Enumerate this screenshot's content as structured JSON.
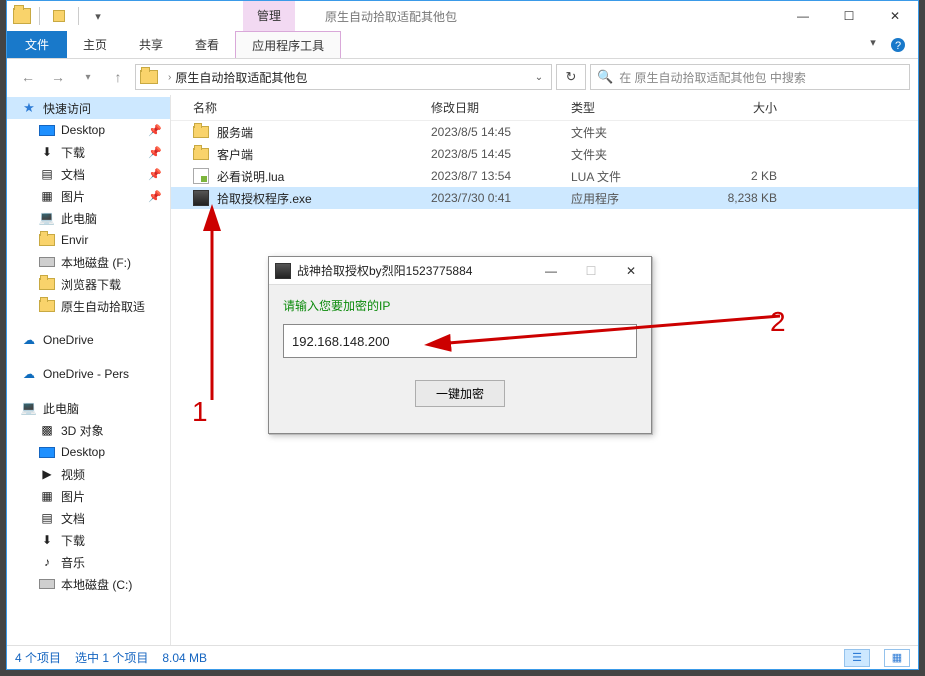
{
  "window": {
    "context_tab_group": "管理",
    "title": "原生自动拾取适配其他包",
    "controls": {
      "min": "—",
      "max": "☐",
      "close": "✕"
    }
  },
  "ribbon": {
    "file": "文件",
    "tabs": [
      "主页",
      "共享",
      "查看"
    ],
    "context_tab": "应用程序工具",
    "expand_icon": "▾"
  },
  "address": {
    "path_segment": "原生自动拾取适配其他包",
    "search_placeholder": "在 原生自动拾取适配其他包 中搜索"
  },
  "sidebar": {
    "quick_access": "快速访问",
    "items": [
      {
        "label": "Desktop",
        "pin": true
      },
      {
        "label": "下载",
        "pin": true
      },
      {
        "label": "文档",
        "pin": true
      },
      {
        "label": "图片",
        "pin": true
      },
      {
        "label": "此电脑",
        "pin": false
      },
      {
        "label": "Envir",
        "pin": false
      },
      {
        "label": "本地磁盘 (F:)",
        "pin": false
      },
      {
        "label": "浏览器下载",
        "pin": false
      },
      {
        "label": "原生自动拾取适",
        "pin": false
      }
    ],
    "onedrive": "OneDrive",
    "onedrive_personal": "OneDrive - Pers",
    "this_pc": "此电脑",
    "pc_items": [
      "3D 对象",
      "Desktop",
      "视频",
      "图片",
      "文档",
      "下载",
      "音乐",
      "本地磁盘 (C:)"
    ]
  },
  "columns": {
    "name": "名称",
    "date": "修改日期",
    "type": "类型",
    "size": "大小"
  },
  "files": [
    {
      "name": "服务端",
      "date": "2023/8/5 14:45",
      "type": "文件夹",
      "size": ""
    },
    {
      "name": "客户端",
      "date": "2023/8/5 14:45",
      "type": "文件夹",
      "size": ""
    },
    {
      "name": "必看说明.lua",
      "date": "2023/8/7 13:54",
      "type": "LUA 文件",
      "size": "2 KB"
    },
    {
      "name": "拾取授权程序.exe",
      "date": "2023/7/30 0:41",
      "type": "应用程序",
      "size": "8,238 KB"
    }
  ],
  "status": {
    "count": "4 个项目",
    "selection": "选中 1 个项目",
    "size": "8.04 MB"
  },
  "dialog": {
    "title": "战神拾取授权by烈阳1523775884",
    "label": "请输入您要加密的IP",
    "value": "192.168.148.200",
    "submit": "一键加密"
  },
  "annotations": {
    "a1": "1",
    "a2": "2"
  }
}
